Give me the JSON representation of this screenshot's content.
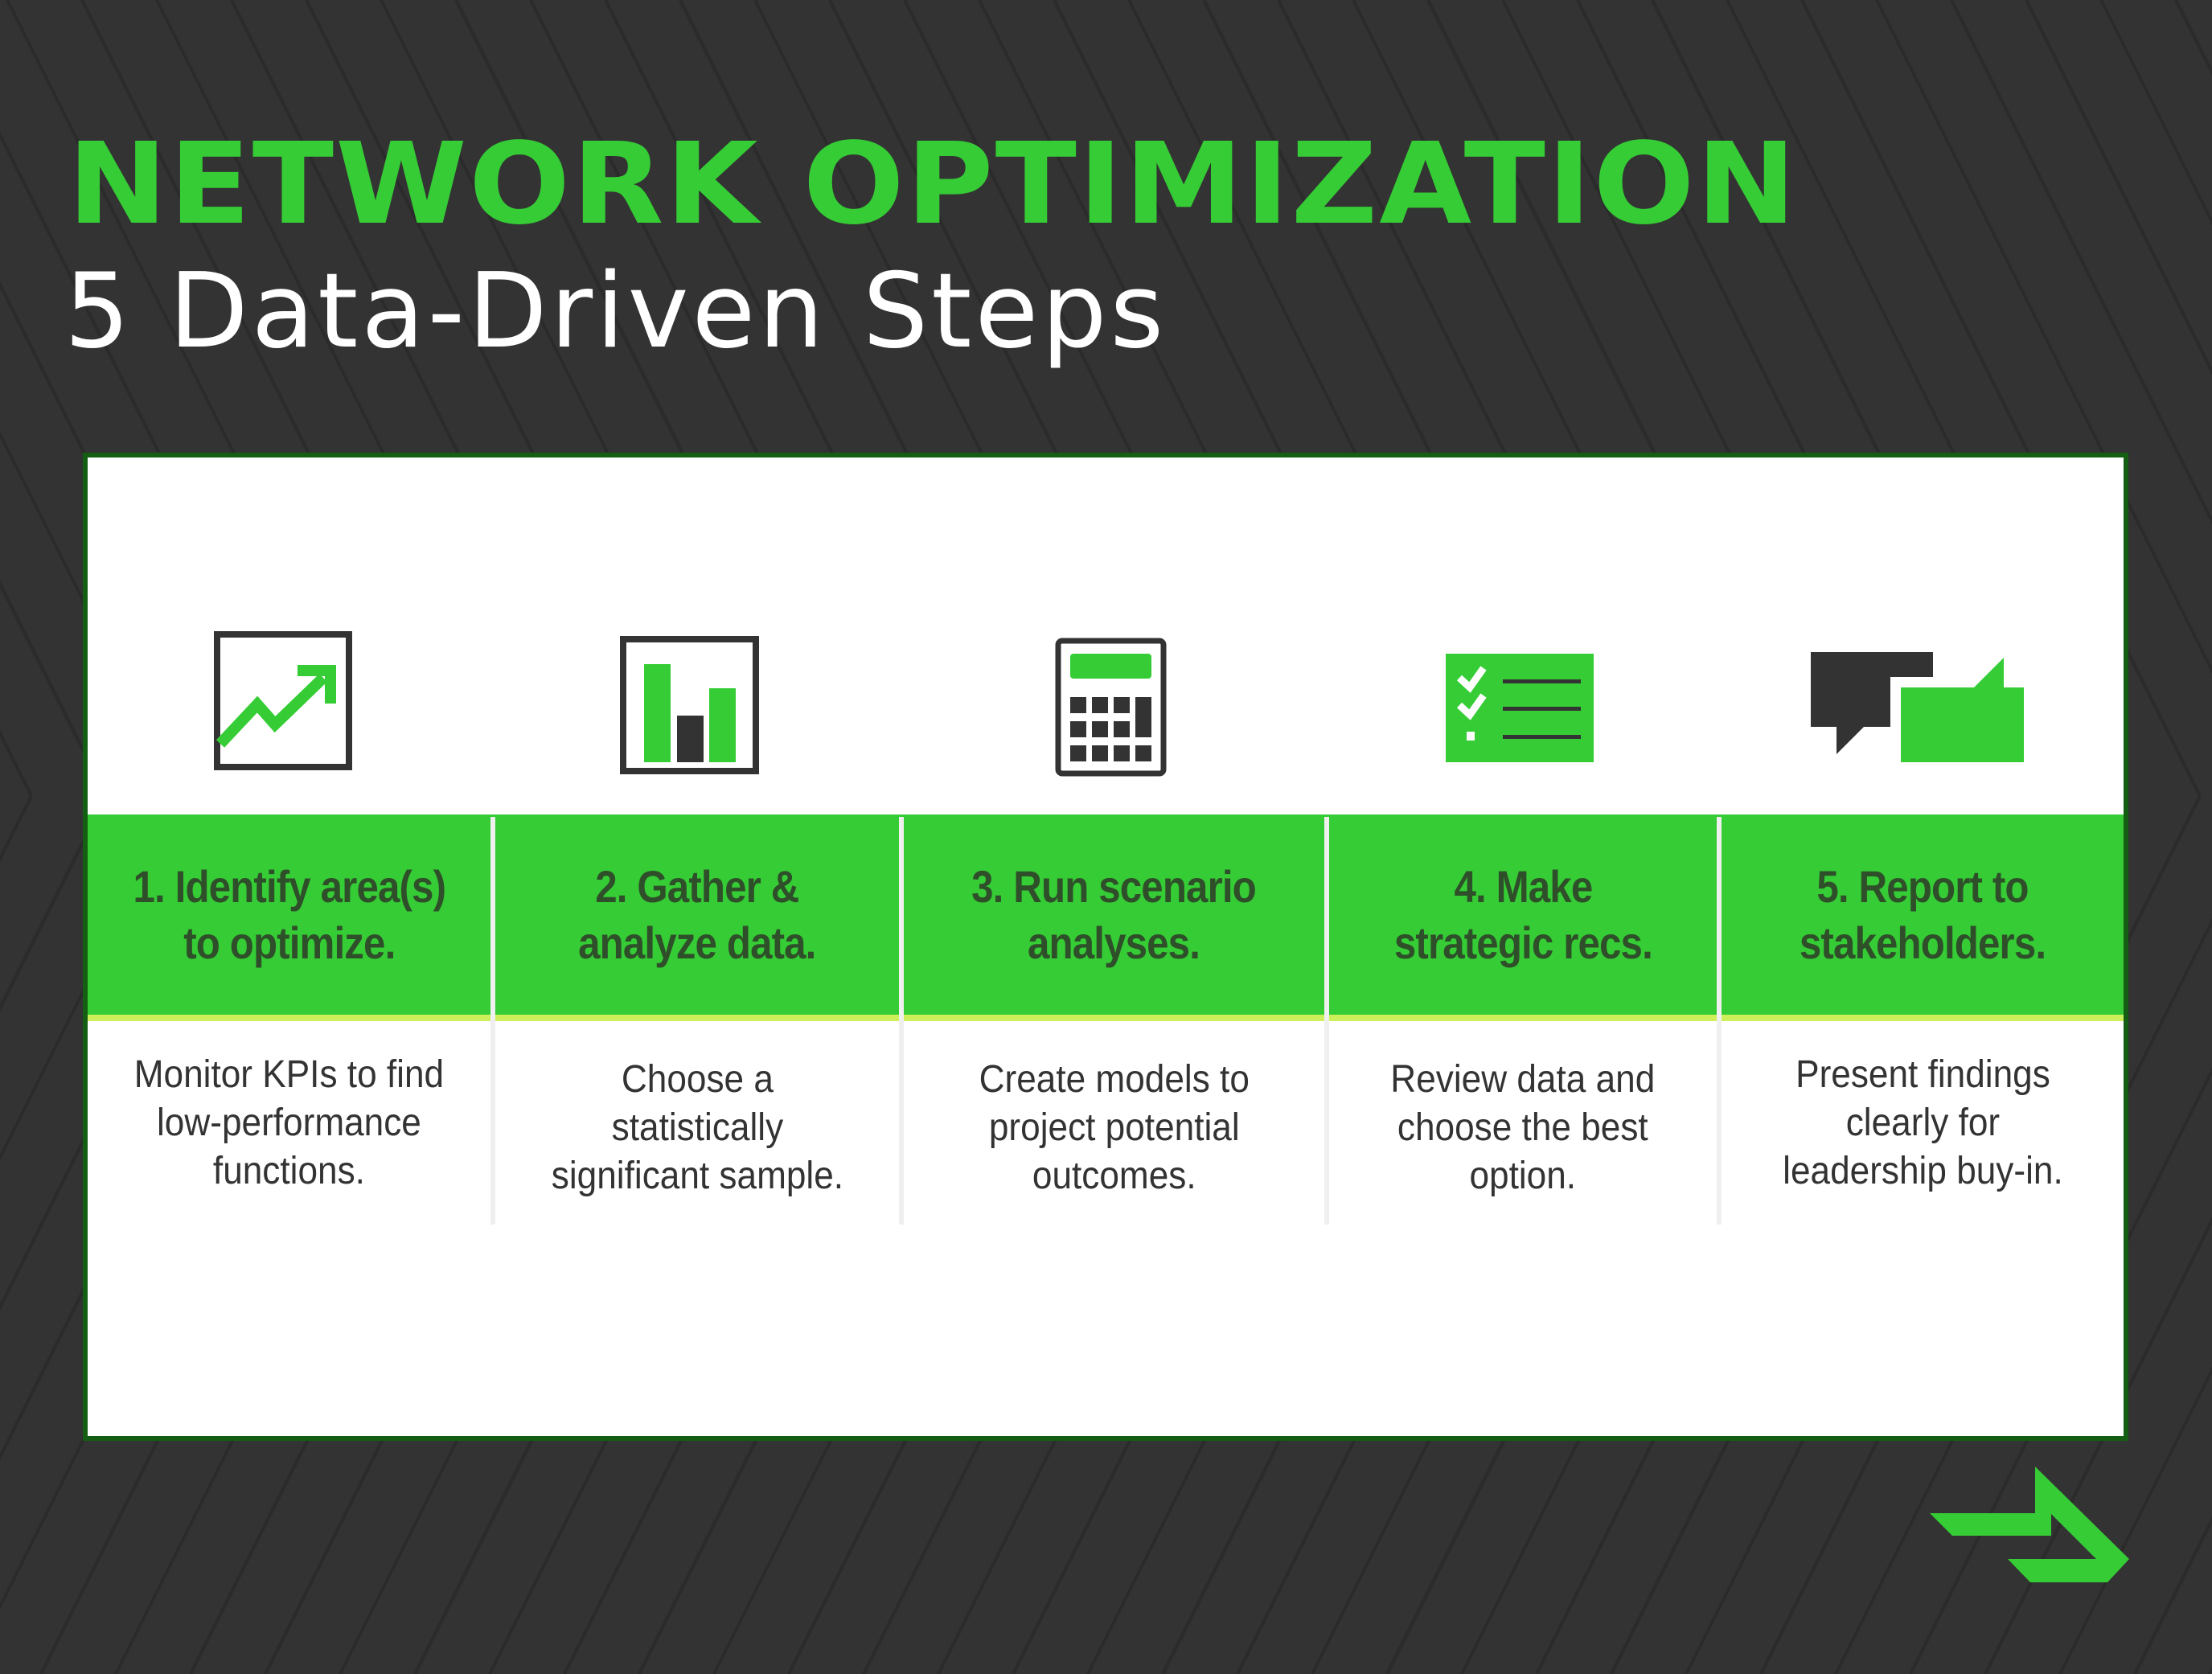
{
  "title": "NETWORK OPTIMIZATION",
  "subtitle": "5 Data-Driven Steps",
  "colors": {
    "background": "#333333",
    "stripe": "#2b2b2b",
    "accent_green": "#35cc35",
    "card_border": "#135e13",
    "band_text": "#2f4f2a",
    "lime_stripe": "#cdf05a",
    "icon_dark": "#333333",
    "body_text": "#333333"
  },
  "steps": [
    {
      "icon": "trend-up-chart-icon",
      "heading_lines": [
        "1. Identify area(s)",
        "to optimize."
      ],
      "description_lines": [
        "Monitor KPIs to find",
        "low-performance",
        "functions."
      ]
    },
    {
      "icon": "bar-chart-icon",
      "heading_lines": [
        "2. Gather &",
        "analyze data."
      ],
      "description_lines": [
        "Choose a",
        "statistically",
        "significant sample."
      ]
    },
    {
      "icon": "calculator-icon",
      "heading_lines": [
        "3. Run scenario",
        "analyses."
      ],
      "description_lines": [
        "Create models to",
        "project potential",
        "outcomes."
      ]
    },
    {
      "icon": "checklist-icon",
      "heading_lines": [
        "4. Make",
        "strategic recs."
      ],
      "description_lines": [
        "Review data and",
        "choose the best",
        "option."
      ]
    },
    {
      "icon": "chat-bubbles-icon",
      "heading_lines": [
        "5. Report to",
        "stakeholders."
      ],
      "description_lines": [
        "Present findings",
        "clearly for",
        "leadership buy-in."
      ]
    }
  ],
  "logo": {
    "icon": "brand-arrow-logo-icon"
  }
}
